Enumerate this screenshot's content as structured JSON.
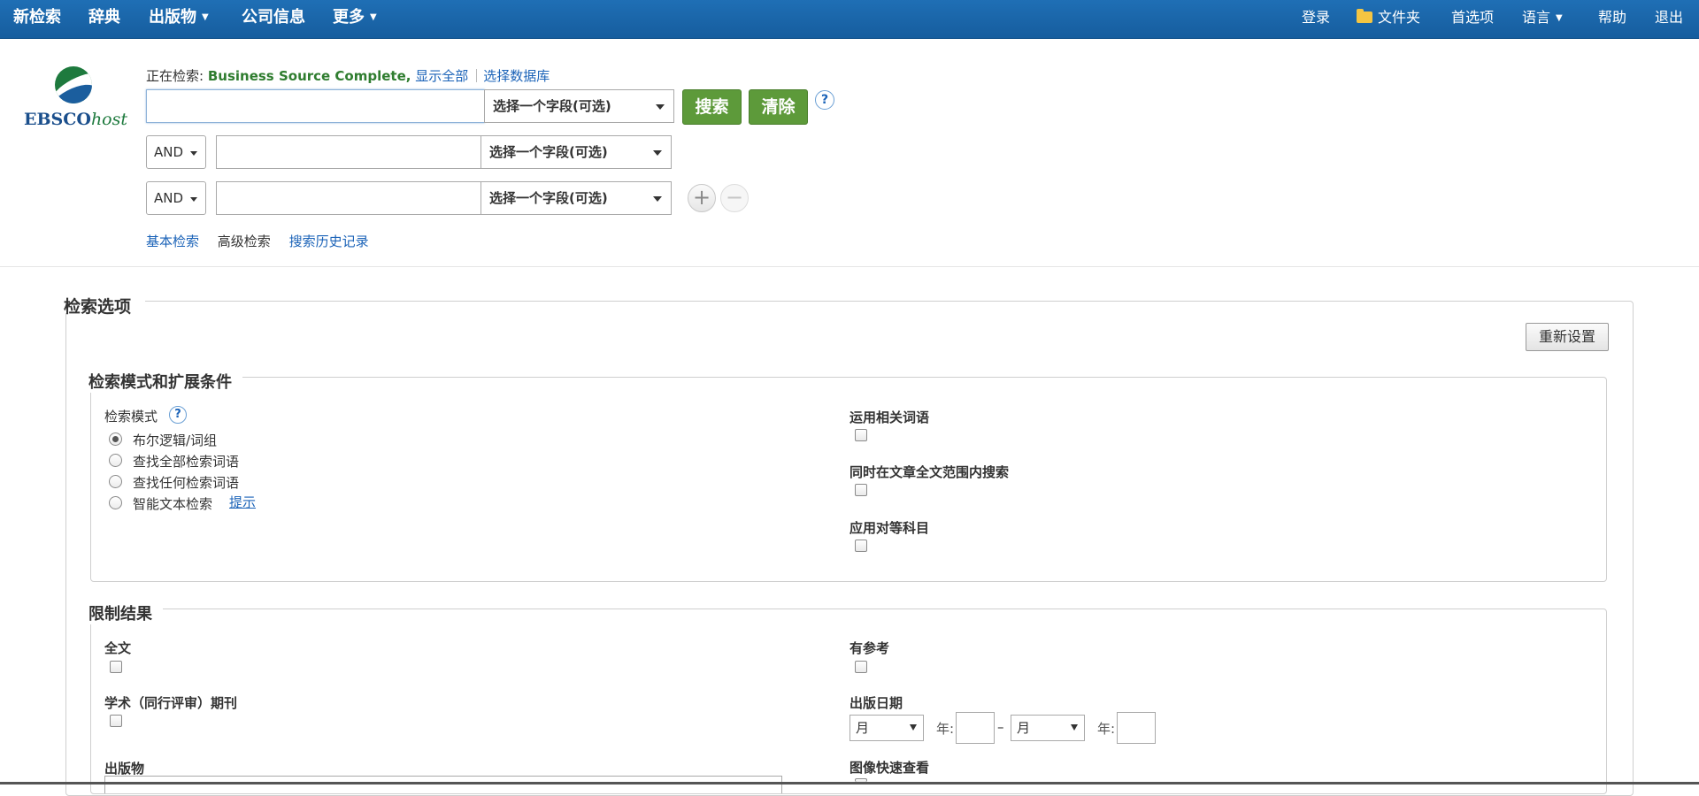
{
  "topnav": {
    "new_search": "新检索",
    "dictionary": "辞典",
    "publications": "出版物",
    "company_info": "公司信息",
    "more": "更多",
    "login": "登录",
    "folder": "文件夹",
    "preferences": "首选项",
    "language": "语言",
    "help": "帮助",
    "logout": "退出"
  },
  "logo": {
    "main": "EBSCO",
    "suffix": "host"
  },
  "search": {
    "searching_label": "正在检索:",
    "database": "Business Source Complete,",
    "show_all": "显示全部",
    "choose_db": "选择数据库",
    "field_placeholder": "选择一个字段(可选)",
    "search_button": "搜索",
    "clear_button": "清除",
    "help": "?",
    "rows": [
      {
        "bool": "",
        "field": "选择一个字段(可选)"
      },
      {
        "bool": "AND",
        "field": "选择一个字段(可选)"
      },
      {
        "bool": "AND",
        "field": "选择一个字段(可选)"
      }
    ],
    "add": "+",
    "remove": "−",
    "modes": {
      "basic": "基本检索",
      "advanced": "高级检索",
      "history": "搜索历史记录"
    }
  },
  "options": {
    "title": "检索选项",
    "reset": "重新设置",
    "modes_section": {
      "legend": "检索模式和扩展条件",
      "mode_label": "检索模式",
      "mode_help": "?",
      "radios": [
        {
          "label": "布尔逻辑/词组",
          "checked": true
        },
        {
          "label": "查找全部检索词语",
          "checked": false
        },
        {
          "label": "查找任何检索词语",
          "checked": false
        },
        {
          "label": "智能文本检索",
          "checked": false
        }
      ],
      "hint": "提示",
      "apply_related": "运用相关词语",
      "fulltext_search": "同时在文章全文范围内搜索",
      "equivalent_subjects": "应用对等科目"
    },
    "limit_section": {
      "legend": "限制结果",
      "fulltext": "全文",
      "scholarly": "学术（同行评审）期刊",
      "publication": "出版物",
      "references": "有参考",
      "pub_date": "出版日期",
      "month": "月",
      "year": "年:",
      "dash": "–",
      "image_quick": "图像快速查看"
    }
  },
  "colors": {
    "nav_bg": "#1f6fb5",
    "green_button": "#5d9a3a",
    "link": "#1b63b8",
    "db_name": "#2f7d2f"
  }
}
